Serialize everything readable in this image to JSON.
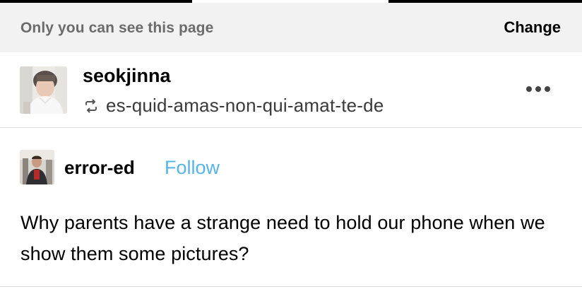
{
  "privacy_bar": {
    "message": "Only you can see this page",
    "change_label": "Change"
  },
  "reblog": {
    "username": "seokjinna",
    "source": "es-quid-amas-non-qui-amat-te-de",
    "avatar_icon": "avatar-image",
    "reblog_icon": "reblog-icon",
    "more_icon": "more-options-icon"
  },
  "post": {
    "author": "error-ed",
    "follow_label": "Follow",
    "body": "Why parents have a strange need to hold our phone when we show them some pictures?"
  },
  "colors": {
    "follow_link": "#56b4ea",
    "privacy_bar_bg": "#f2f2f2",
    "privacy_text": "#6b6b6b",
    "divider": "#dcdcdc"
  }
}
